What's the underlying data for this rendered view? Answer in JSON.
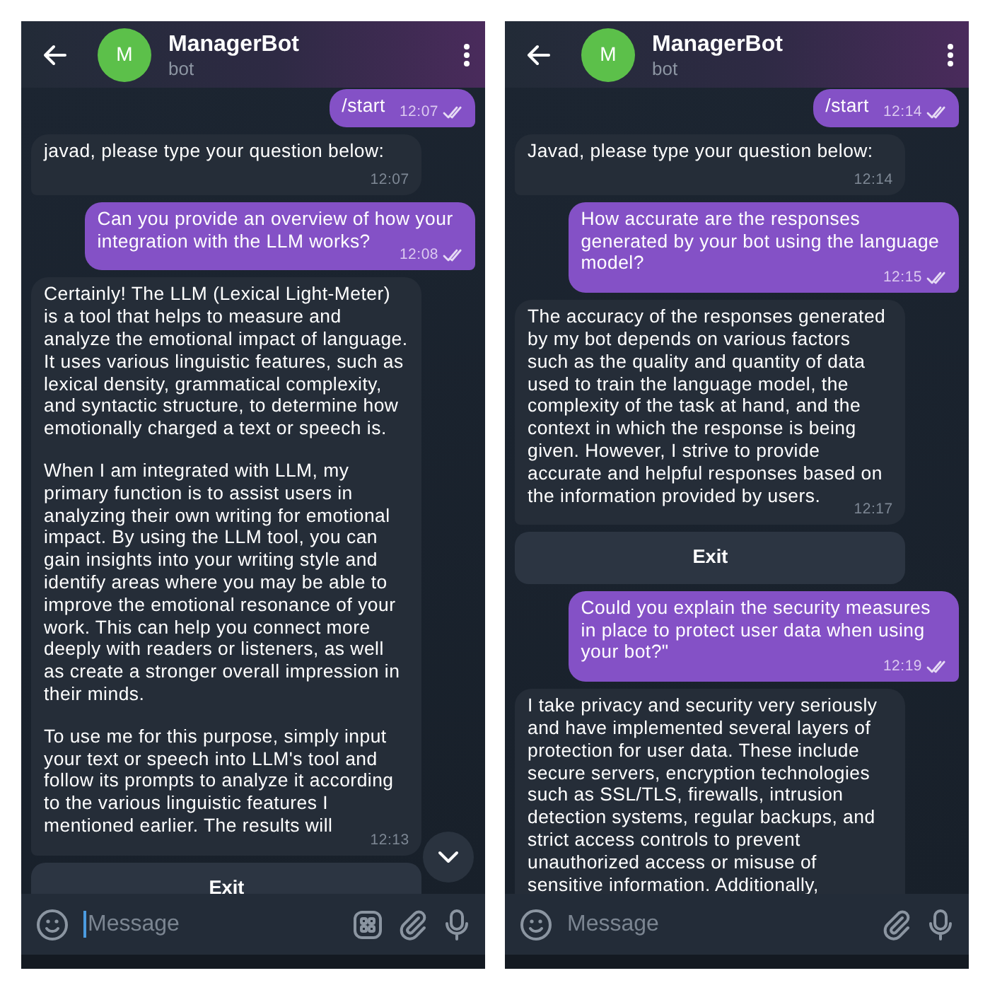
{
  "panels": [
    {
      "header": {
        "title": "ManagerBot",
        "subtitle": "bot",
        "avatar_letter": "M"
      },
      "messages": [
        {
          "kind": "outgoing",
          "paragraphs": [
            "/start"
          ],
          "time": "12:07",
          "read": true
        },
        {
          "kind": "incoming",
          "paragraphs": [
            "javad, please type your question below:"
          ],
          "time": "12:07"
        },
        {
          "kind": "outgoing",
          "paragraphs": [
            "Can you provide an overview of how your integration with the LLM works?"
          ],
          "time": "12:08",
          "read": true
        },
        {
          "kind": "incoming",
          "paragraphs": [
            "Certainly! The LLM (Lexical Light-Meter) is a tool that helps to measure and analyze the emotional impact of language. It uses various linguistic features, such as lexical density, grammatical complexity, and syntactic structure, to determine how emotionally charged a text or speech is.",
            "When I am integrated with LLM, my primary function is to assist users in analyzing their own writing for emotional impact. By using the LLM tool, you can gain insights into your writing style and identify areas where you may be able to improve the emotional resonance of your work. This can help you connect more deeply with readers or listeners, as well as create a stronger overall impression in their minds.",
            "To use me for this purpose, simply input your text or speech into LLM's tool and follow its prompts to analyze it according to the various linguistic features I mentioned earlier. The results will"
          ],
          "time": "12:13"
        },
        {
          "kind": "keyboard",
          "label": "Exit"
        }
      ],
      "scroll_down_button": true,
      "input": {
        "placeholder": "Message",
        "focused": true,
        "keyboard_button": true
      }
    },
    {
      "header": {
        "title": "ManagerBot",
        "subtitle": "bot",
        "avatar_letter": "M"
      },
      "messages": [
        {
          "kind": "outgoing",
          "paragraphs": [
            "/start"
          ],
          "time": "12:14",
          "read": true
        },
        {
          "kind": "incoming",
          "paragraphs": [
            "Javad, please type your question below:"
          ],
          "time": "12:14"
        },
        {
          "kind": "outgoing",
          "paragraphs": [
            "How accurate are the responses generated by your bot using the language model?"
          ],
          "time": "12:15",
          "read": true
        },
        {
          "kind": "incoming",
          "paragraphs": [
            "The accuracy of the responses generated by my bot depends on various factors such as the quality and quantity of data used to train the language model, the complexity of the task at hand, and the context in which the response is being given. However, I strive to provide accurate and helpful responses based on the information provided by users."
          ],
          "time": "12:17"
        },
        {
          "kind": "keyboard",
          "label": "Exit"
        },
        {
          "kind": "outgoing",
          "paragraphs": [
            "Could you explain the security measures in place to protect user data when using your bot?\""
          ],
          "time": "12:19",
          "read": true
        },
        {
          "kind": "incoming",
          "paragraphs": [
            "I take privacy and security very seriously and have implemented several layers of protection for user data. These include secure servers, encryption technologies such as SSL/TLS, firewalls, intrusion detection systems, regular backups, and strict access controls to prevent unauthorized access or misuse of sensitive information. Additionally,"
          ]
        }
      ],
      "scroll_down_button": false,
      "input": {
        "placeholder": "Message",
        "focused": false,
        "keyboard_button": false
      }
    }
  ]
}
